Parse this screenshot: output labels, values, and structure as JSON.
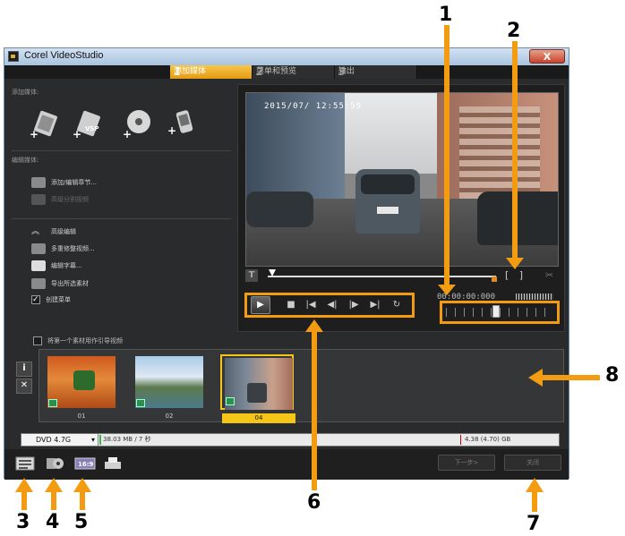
{
  "window": {
    "title": "Corel VideoStudio",
    "close_label": "X"
  },
  "tabs": [
    {
      "num": "1",
      "label": "添加媒体",
      "active": true
    },
    {
      "num": "2",
      "label": "菜单和预览",
      "active": false
    },
    {
      "num": "3",
      "label": "输出",
      "active": false
    }
  ],
  "left_panel": {
    "add_media_label": "添加媒体:",
    "edit_media_label": "编辑媒体:",
    "edit_items": [
      {
        "label": "添加/编辑章节...",
        "enabled": true
      },
      {
        "label": "高级分割视频",
        "enabled": false
      }
    ],
    "tools": [
      {
        "label": "高级编辑"
      },
      {
        "label": "多重修整视频..."
      },
      {
        "label": "编辑字幕..."
      },
      {
        "label": "导出所选素材"
      }
    ],
    "create_menu_label": "创建菜单",
    "create_menu_checked": true
  },
  "preview": {
    "timestamp": "2015/07/ 12:55:59",
    "timecode": "00:00:00:000",
    "trim_marks": "[ ]"
  },
  "strip": {
    "use_first_clip_label": "将第一个素材用作引导视频",
    "clips": [
      {
        "caption": "01",
        "selected": false
      },
      {
        "caption": "02",
        "selected": false
      },
      {
        "caption": "04",
        "selected": true
      }
    ]
  },
  "status": {
    "disc": "DVD 4.7G",
    "used": "38.03 MB / 7 秒",
    "capacity": "4.38 (4.70) GB"
  },
  "buttons": {
    "next": "下一步>",
    "close": "关闭"
  },
  "callouts": [
    "1",
    "2",
    "3",
    "4",
    "5",
    "6",
    "7",
    "8"
  ],
  "colors": {
    "accent": "#f39c12",
    "selected": "#f5c518",
    "tab_active": "#f0b030"
  }
}
